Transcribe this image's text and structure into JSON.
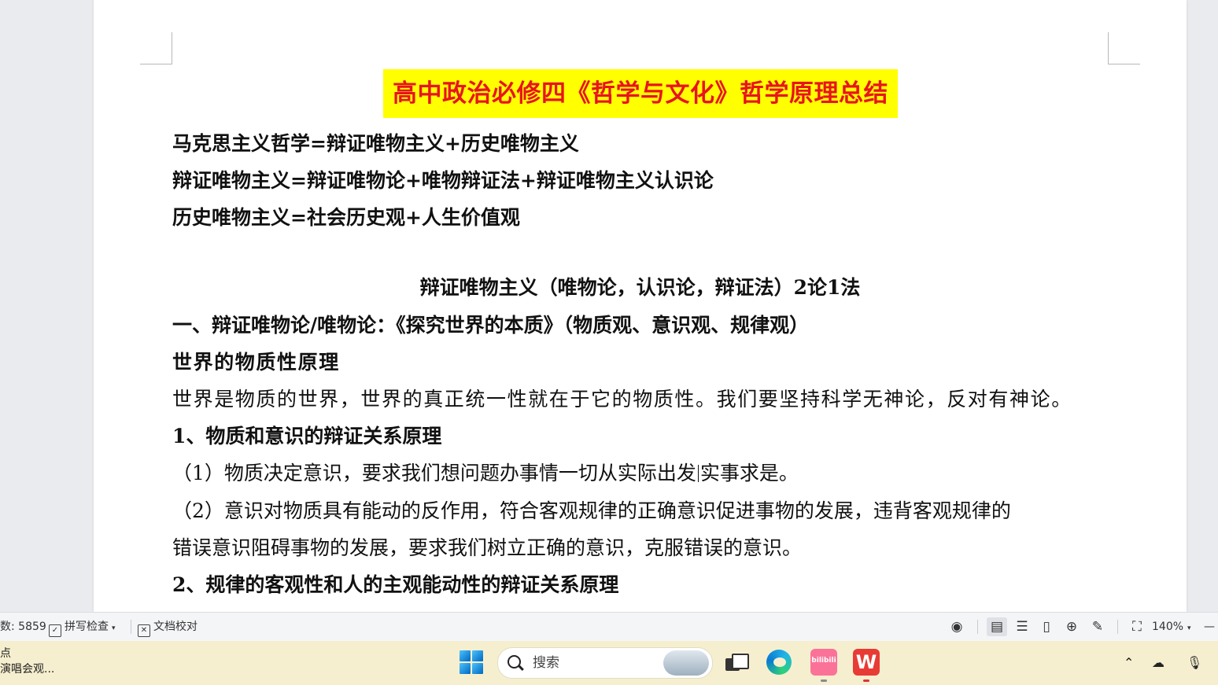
{
  "document": {
    "title": "高中政治必修四《哲学与文化》哲学原理总结",
    "lines": [
      "马克思主义哲学=辩证唯物主义+历史唯物主义",
      "辩证唯物主义=辩证唯物论+唯物辩证法+辩证唯物主义认识论",
      "历史唯物主义=社会历史观+人生价值观",
      "辩证唯物主义（唯物论，认识论，辩证法）2论1法",
      "一、辩证唯物论/唯物论：《探究世界的本质》（物质观、意识观、规律观）",
      "世界的物质性原理",
      "世界是物质的世界，世界的真正统一性就在于它的物质性。我们要坚持科学无神论，反对有神论。",
      "1、物质和意识的辩证关系原理",
      "（1）物质决定意识，要求我们想问题办事情一切从实际出发",
      "实事求是。",
      "（2）意识对物质具有能动的反作用，符合客观规律的正确意识促进事物的发展，违背客观规律的",
      "错误意识阻碍事物的发展，要求我们树立正确的意识，克服错误的意识。",
      "2、规律的客观性和人的主观能动性的辩证关系原理"
    ]
  },
  "statusbar": {
    "word_count": "数: 5859",
    "spell_check": "拼写检查",
    "doc_proofread": "文档校对",
    "zoom": "140%"
  },
  "taskbar": {
    "news_line1": "点",
    "news_line2": "演唱会观...",
    "search_placeholder": "搜索",
    "wps_label": "W"
  },
  "colors": {
    "title_bg": "#ffff00",
    "title_text": "#e8141e",
    "taskbar_bg": "#f6efcf"
  }
}
